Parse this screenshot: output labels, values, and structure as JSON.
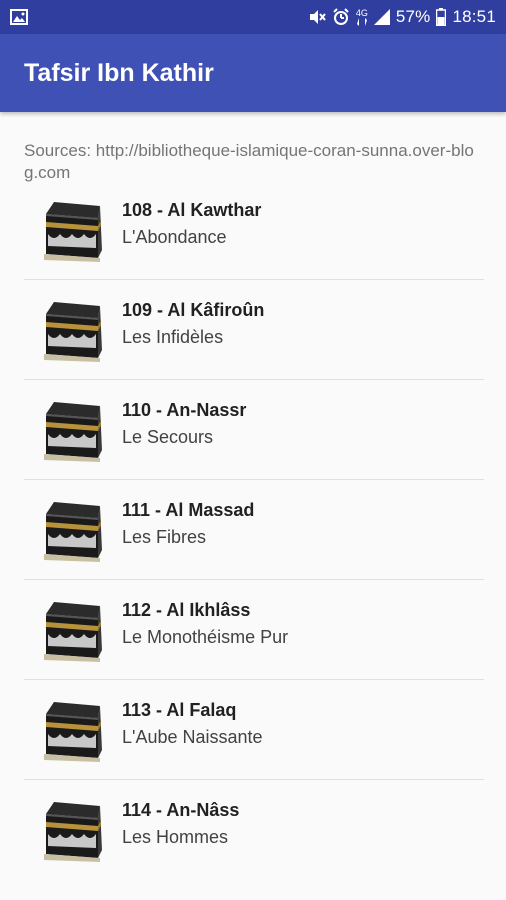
{
  "status_bar": {
    "time": "18:51",
    "battery": "57%",
    "network": "4G",
    "icons": [
      "image-notification-icon",
      "mute-icon",
      "alarm-icon",
      "network-4g-icon",
      "signal-icon",
      "battery-icon"
    ]
  },
  "app_bar": {
    "title": "Tafsir Ibn Kathir",
    "color": "#3F51B5",
    "status_color": "#303F9F"
  },
  "sources": {
    "text": "Sources:  http://bibliotheque-islamique-coran-sunna.over-blog.com"
  },
  "items": [
    {
      "title": "108 - Al Kawthar",
      "subtitle": "L'Abondance",
      "icon": "kaaba-icon"
    },
    {
      "title": "109 - Al Kâfiroûn",
      "subtitle": "Les Infidèles",
      "icon": "kaaba-icon"
    },
    {
      "title": "110 - An-Nassr",
      "subtitle": "Le Secours",
      "icon": "kaaba-icon"
    },
    {
      "title": "111 - Al Massad",
      "subtitle": "Les Fibres",
      "icon": "kaaba-icon"
    },
    {
      "title": "112 - Al Ikhlâss",
      "subtitle": "Le Monothéisme Pur",
      "icon": "kaaba-icon"
    },
    {
      "title": "113 - Al Falaq",
      "subtitle": "L'Aube Naissante",
      "icon": "kaaba-icon"
    },
    {
      "title": "114 - An-Nâss",
      "subtitle": "Les Hommes",
      "icon": "kaaba-icon"
    }
  ]
}
